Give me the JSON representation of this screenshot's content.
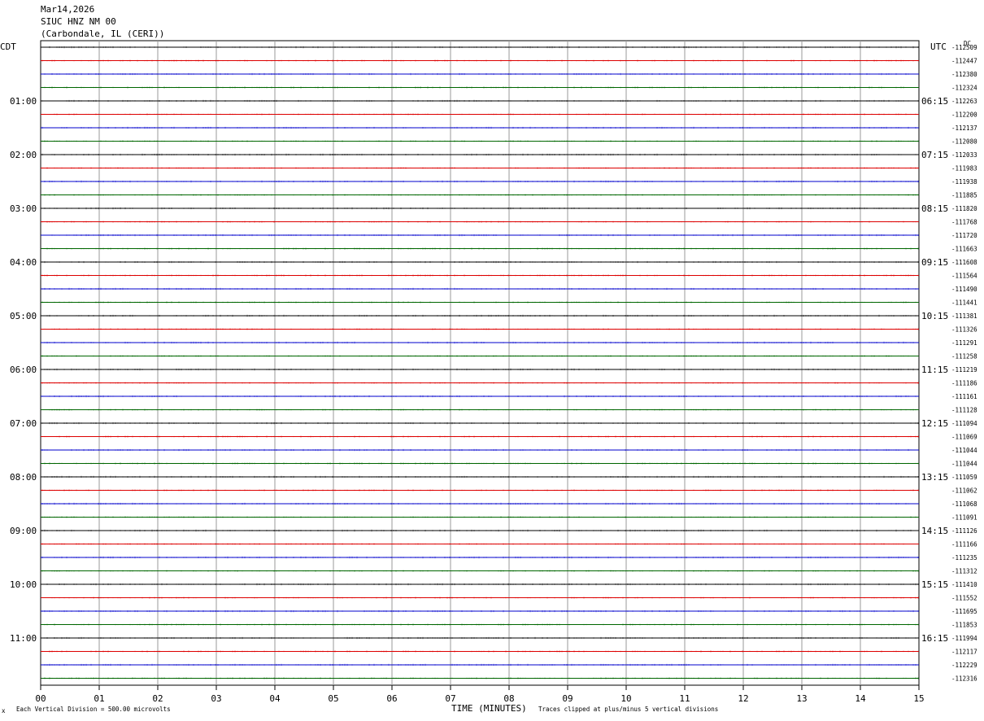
{
  "header": {
    "date": "Mar14,2026",
    "station": "SIUC HNZ NM 00",
    "location": "(Carbondale, IL (CERI))"
  },
  "left_zone": "CDT",
  "right_zone": "UTC",
  "dc_label": "DC",
  "chart_data": {
    "type": "line",
    "subtype": "helicorder",
    "xlabel": "TIME (MINUTES)",
    "x_ticks": [
      "00",
      "01",
      "02",
      "03",
      "04",
      "05",
      "06",
      "07",
      "08",
      "09",
      "10",
      "11",
      "12",
      "13",
      "14",
      "15"
    ],
    "xlim": [
      0,
      15
    ],
    "rows_per_hour": 4,
    "trace_colors": [
      "#000000",
      "#dd0000",
      "#0000cc",
      "#006600"
    ],
    "left_hour_labels": [
      "01:00",
      "02:00",
      "03:00",
      "04:00",
      "05:00",
      "06:00",
      "07:00",
      "08:00",
      "09:00",
      "10:00",
      "11:00"
    ],
    "right_hour_labels": [
      "06:15",
      "07:15",
      "08:15",
      "09:15",
      "10:15",
      "11:15",
      "12:15",
      "13:15",
      "14:15",
      "15:15",
      "16:15"
    ],
    "row_offsets": [
      "-112509",
      "-112447",
      "-112380",
      "-112324",
      "-112263",
      "-112200",
      "-112137",
      "-112080",
      "-112033",
      "-111983",
      "-111938",
      "-111885",
      "-111820",
      "-111768",
      "-111720",
      "-111663",
      "-111608",
      "-111564",
      "-111490",
      "-111441",
      "-111381",
      "-111326",
      "-111291",
      "-111258",
      "-111219",
      "-111186",
      "-111161",
      "-111128",
      "-111094",
      "-111069",
      "-111044",
      "-111044",
      "-111059",
      "-111062",
      "-111068",
      "-111091",
      "-111126",
      "-111166",
      "-111235",
      "-111312",
      "-111410",
      "-111552",
      "-111695",
      "-111853",
      "-111994",
      "-112117",
      "-112229",
      "-112316"
    ]
  },
  "footer": {
    "scale": "Each Vertical Division =  500.00 microvolts",
    "clip": "Traces clipped at plus/minus 5 vertical divisions",
    "mark": "x"
  }
}
